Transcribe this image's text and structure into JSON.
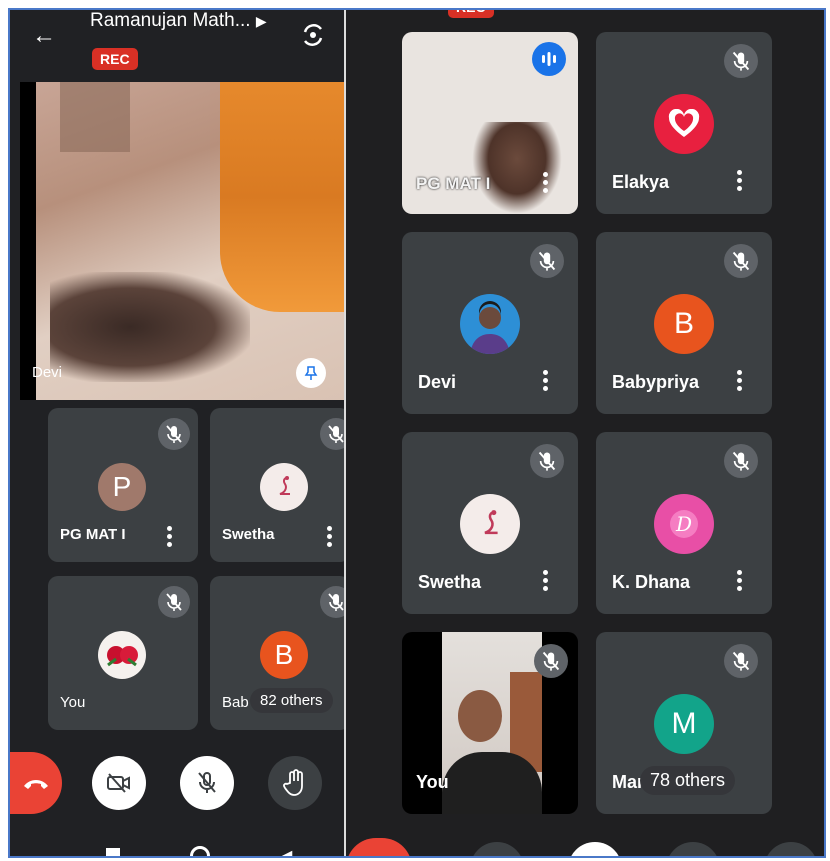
{
  "left": {
    "title": "Ramanujan Math...",
    "rec_label": "REC",
    "featured_name": "Devi",
    "tiles": [
      {
        "name": "PG MAT I",
        "avatar_letter": "P",
        "avatar_color": "#a0796b"
      },
      {
        "name": "Swetha"
      },
      {
        "name": "You"
      },
      {
        "name": "Bab",
        "avatar_letter": "B",
        "avatar_color": "#e8541e"
      }
    ],
    "others_label": "82 others"
  },
  "right": {
    "rec_label": "REC",
    "tiles": [
      {
        "name": "PG MAT I"
      },
      {
        "name": "Elakya"
      },
      {
        "name": "Devi"
      },
      {
        "name": "Babypriya",
        "avatar_letter": "B",
        "avatar_color": "#e8541e"
      },
      {
        "name": "Swetha"
      },
      {
        "name": "K. Dhana"
      },
      {
        "name": "You"
      },
      {
        "name": "Mani",
        "avatar_letter": "M",
        "avatar_color": "#12a48a"
      }
    ],
    "others_label": "78 others"
  },
  "colors": {
    "accent_red": "#ea4335",
    "rec_red": "#d93025",
    "speaking_blue": "#1a73e8"
  }
}
